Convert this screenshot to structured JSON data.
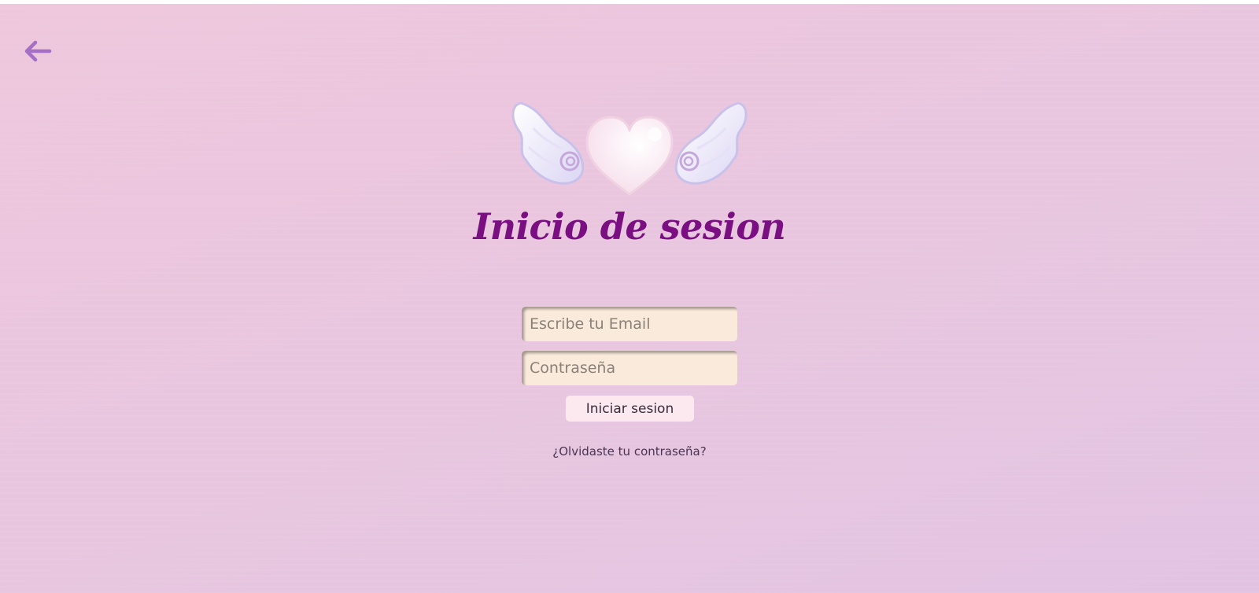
{
  "header": {
    "back_icon": "arrow-left-icon"
  },
  "logo": {
    "icon": "winged-heart-icon"
  },
  "form": {
    "title": "Inicio de sesion",
    "email_placeholder": "Escribe tu Email",
    "email_value": "",
    "password_placeholder": "Contraseña",
    "password_value": "",
    "submit_label": "Iniciar sesion",
    "forgot_label": "¿Olvidaste tu contraseña?"
  },
  "colors": {
    "title": "#7a0f82",
    "back_arrow": "#a56fc6",
    "input_bg": "#faeadb",
    "button_bg": "#fce9f0",
    "background_top": "#eec7dc",
    "background_bottom": "#e2c4e2"
  }
}
